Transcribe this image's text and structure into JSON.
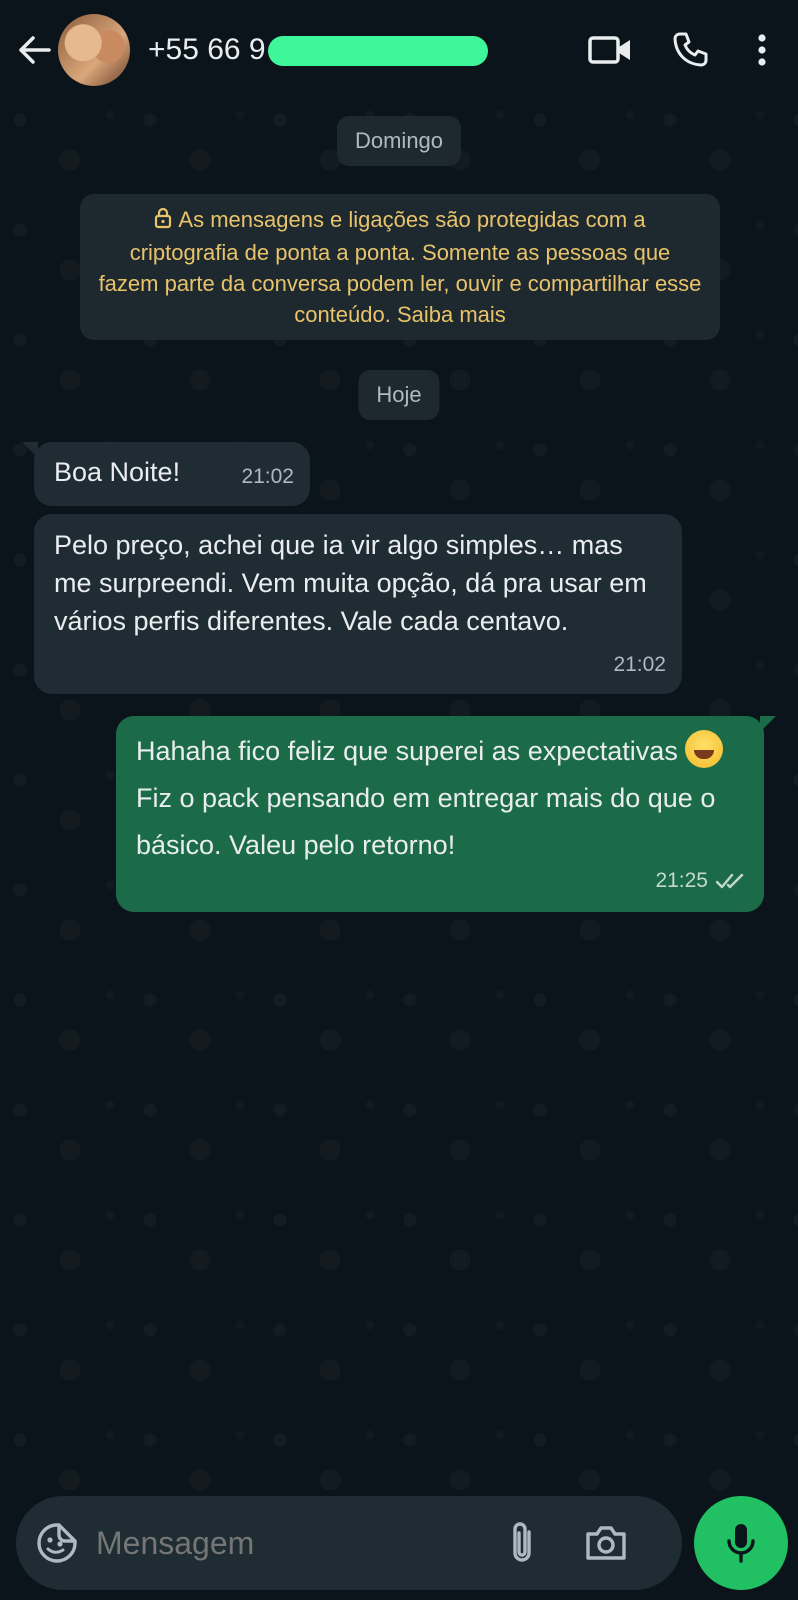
{
  "header": {
    "contact_number": "+55 66 9",
    "icons": [
      "back-arrow-icon",
      "video-call-icon",
      "voice-call-icon",
      "more-options-icon"
    ]
  },
  "chat": {
    "date_chip_1": "Domingo",
    "encryption_notice": "As mensagens e ligações são protegidas com a criptografia de ponta a ponta. Somente as pessoas que fazem parte da conversa podem ler, ouvir e compartilhar esse conteúdo. Saiba mais",
    "date_chip_2": "Hoje",
    "messages": [
      {
        "direction": "incoming",
        "text": "Boa Noite!",
        "time": "21:02"
      },
      {
        "direction": "incoming",
        "text": "Pelo preço, achei que ia vir algo simples… mas me surpreendi. Vem muita opção, dá pra usar em vários perfis diferentes. Vale cada centavo.",
        "time": "21:02"
      },
      {
        "direction": "outgoing",
        "text_before_emoji": "Hahaha fico feliz que superei as expectativas",
        "emoji": "grinning-sweat-emoji",
        "text_after_emoji": "Fiz o pack pensando em entregar mais do que o básico. Valeu pelo retorno!",
        "time": "21:25",
        "status": "read"
      }
    ]
  },
  "composer": {
    "placeholder": "Mensagem"
  },
  "colors": {
    "background": "#0b141a",
    "incoming_bubble": "#1f2c34",
    "outgoing_bubble": "#1b6b48",
    "notice_text": "#e8c36a",
    "mic_button": "#21c063"
  }
}
